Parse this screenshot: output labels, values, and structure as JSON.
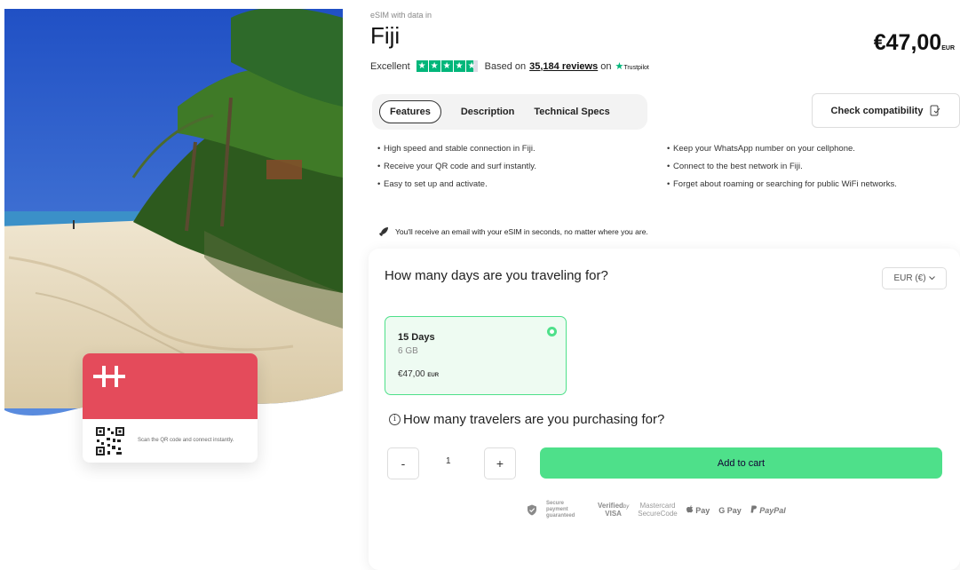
{
  "product": {
    "kicker": "eSIM with data in",
    "title": "Fiji",
    "price": "€47,00",
    "price_currency": "EUR",
    "rating_label": "Excellent",
    "based_on": "Based on",
    "reviews_link": "35,184 reviews",
    "on": "on",
    "trustpilot": "Trustpilot"
  },
  "tabs": [
    "Features",
    "Description",
    "Technical Specs"
  ],
  "active_tab": "Features",
  "compat_button": "Check compatibility",
  "features": {
    "left": [
      "High speed and stable connection in Fiji.",
      "Receive your QR code and surf instantly.",
      "Easy to set up and activate."
    ],
    "right": [
      "Keep your WhatsApp number on your cellphone.",
      "Connect to the best network in Fiji.",
      "Forget about roaming or searching for public WiFi networks."
    ]
  },
  "notice": "You'll receive an email with your eSIM in seconds, no matter where you are.",
  "days_question": "How many days are you traveling for?",
  "currency_select": "EUR (€)",
  "plan": {
    "days": "15 Days",
    "data": "6 GB",
    "price": "€47,00",
    "currency": "EUR"
  },
  "travelers_question": "How many travelers are you purchasing for?",
  "stepper": {
    "minus": "-",
    "quantity": "1",
    "plus": "+"
  },
  "add_to_cart": "Add to cart",
  "payments": {
    "secure": "Secure payment guaranteed",
    "verified_by": "Verified",
    "by": "by",
    "visa": "VISA",
    "mastercard": "Mastercard",
    "securecode": "SecureCode",
    "apple_pay": " Pay",
    "google_pay": "G Pay",
    "paypal": "PayPal"
  },
  "card": {
    "scan_text": "Scan the QR code and connect instantly."
  },
  "colors": {
    "accent_green": "#4ee08a",
    "brand_red": "#e44b5b",
    "trustpilot_green": "#00b67a"
  }
}
